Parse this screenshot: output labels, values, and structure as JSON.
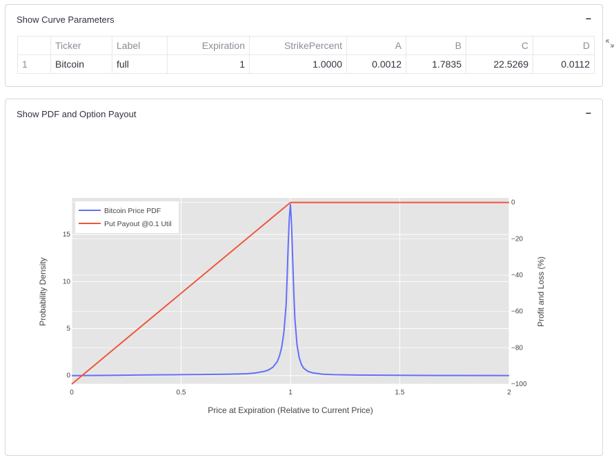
{
  "params_panel": {
    "title": "Show Curve Parameters",
    "collapse_symbol": "−",
    "columns": [
      "",
      "Ticker",
      "Label",
      "Expiration",
      "StrikePercent",
      "A",
      "B",
      "C",
      "D"
    ],
    "rows": [
      [
        "1",
        "Bitcoin",
        "full",
        "1",
        "1.0000",
        "0.0012",
        "1.7835",
        "22.5269",
        "0.0112"
      ]
    ]
  },
  "chart_panel": {
    "title": "Show PDF and Option Payout",
    "collapse_symbol": "−"
  },
  "icons": {
    "expand": "expand-icon",
    "collapse": "minus-icon"
  },
  "colors": {
    "pdf_line": "#636efa",
    "payout_line": "#ef553b",
    "plot_bg": "#e5e5e5"
  },
  "chart_data": {
    "type": "line",
    "xlabel": "Price at Expiration (Relative to Current Price)",
    "ylabel": "Probability Density",
    "y2label": "Profit and Loss (%)",
    "xlim": [
      0,
      2
    ],
    "ylim": [
      -0.9,
      18.9
    ],
    "y2lim": [
      -100,
      2.5
    ],
    "xticks": [
      0,
      0.5,
      1,
      1.5,
      2
    ],
    "xtick_labels": [
      "0",
      "0.5",
      "1",
      "1.5",
      "2"
    ],
    "yticks": [
      0,
      5,
      10,
      15
    ],
    "ytick_labels": [
      "0",
      "5",
      "10",
      "15"
    ],
    "y2ticks": [
      0,
      -20,
      -40,
      -60,
      -80,
      -100
    ],
    "y2tick_labels": [
      "0",
      "−20",
      "−40",
      "−60",
      "−80",
      "−100"
    ],
    "grid": true,
    "legend_position": "top-left",
    "series": [
      {
        "name": "Bitcoin Price PDF",
        "axis": "y",
        "x": [
          0,
          0.1,
          0.2,
          0.3,
          0.4,
          0.5,
          0.6,
          0.7,
          0.8,
          0.84,
          0.88,
          0.9,
          0.92,
          0.94,
          0.95,
          0.96,
          0.97,
          0.98,
          0.985,
          0.99,
          0.995,
          1.0,
          1.005,
          1.01,
          1.015,
          1.02,
          1.03,
          1.04,
          1.05,
          1.06,
          1.08,
          1.1,
          1.15,
          1.2,
          1.3,
          1.5,
          1.75,
          2.0
        ],
        "y": [
          0.0,
          0.02,
          0.04,
          0.06,
          0.08,
          0.1,
          0.12,
          0.15,
          0.2,
          0.28,
          0.45,
          0.6,
          0.9,
          1.5,
          2.1,
          3.0,
          4.6,
          7.5,
          10.5,
          14.0,
          16.8,
          18.2,
          16.0,
          12.5,
          9.0,
          6.2,
          3.3,
          1.9,
          1.2,
          0.8,
          0.45,
          0.3,
          0.15,
          0.1,
          0.06,
          0.03,
          0.02,
          0.01
        ]
      },
      {
        "name": "Put Payout @0.1 Util",
        "axis": "y2",
        "x": [
          0,
          1,
          2
        ],
        "y": [
          -100,
          0,
          0
        ]
      }
    ]
  }
}
